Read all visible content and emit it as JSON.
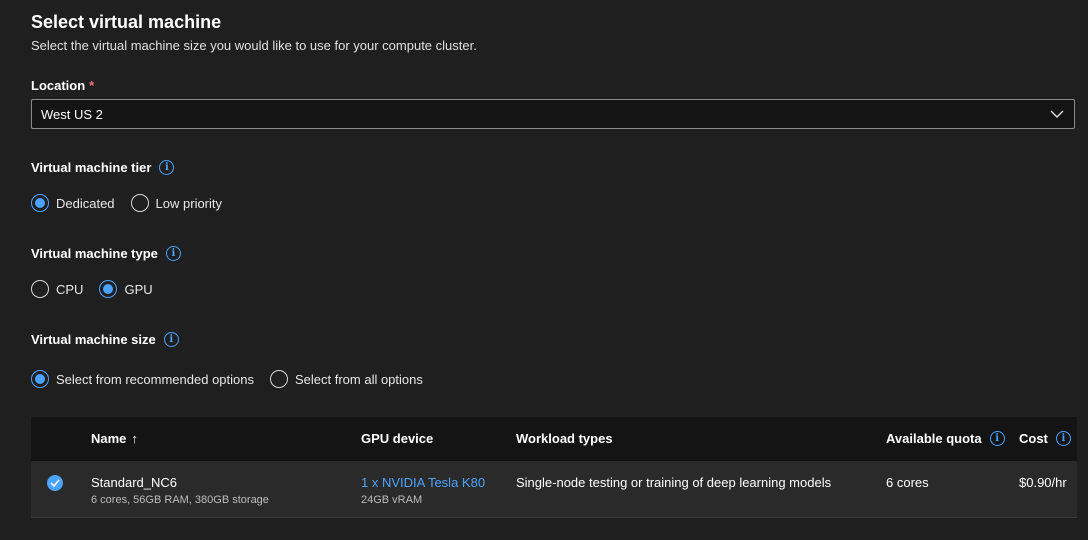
{
  "header": {
    "title": "Select virtual machine",
    "subtitle": "Select the virtual machine size you would like to use for your compute cluster."
  },
  "location": {
    "label": "Location",
    "required_mark": "*",
    "value": "West US 2"
  },
  "tier": {
    "label": "Virtual machine tier",
    "options": [
      {
        "label": "Dedicated",
        "selected": true
      },
      {
        "label": "Low priority",
        "selected": false
      }
    ]
  },
  "type": {
    "label": "Virtual machine type",
    "options": [
      {
        "label": "CPU",
        "selected": false
      },
      {
        "label": "GPU",
        "selected": true
      }
    ]
  },
  "size": {
    "label": "Virtual machine size",
    "options": [
      {
        "label": "Select from recommended options",
        "selected": true
      },
      {
        "label": "Select from all options",
        "selected": false
      }
    ]
  },
  "table": {
    "columns": {
      "name": "Name",
      "sort_indicator": "↑",
      "gpu": "GPU device",
      "workload": "Workload types",
      "quota": "Available quota",
      "cost": "Cost"
    },
    "rows": [
      {
        "name": "Standard_NC6",
        "specs": "6 cores, 56GB RAM, 380GB storage",
        "gpu": "1 x NVIDIA Tesla K80",
        "gpu_sub": "24GB vRAM",
        "workload": "Single-node testing or training of deep learning models",
        "quota": "6 cores",
        "cost": "$0.90/hr"
      }
    ]
  },
  "icons": {
    "info": "info-icon",
    "dropdown": "chevron-down-icon",
    "row_selected": "checkmark-circle-icon"
  },
  "colors": {
    "accent": "#4aa3ff",
    "required": "#f1707b",
    "background": "#1f1f1f"
  }
}
